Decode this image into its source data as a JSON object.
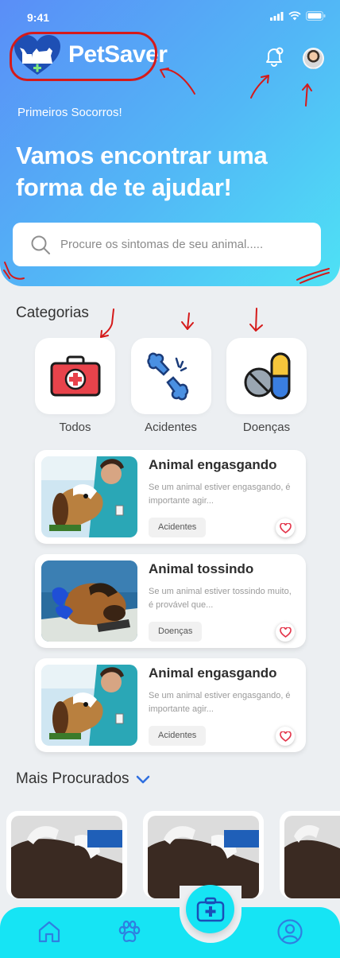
{
  "status": {
    "time": "9:41"
  },
  "header": {
    "brand": "PetSaver",
    "subtitle": "Primeiros Socorros!",
    "headline": "Vamos encontrar uma forma de te ajudar!"
  },
  "search": {
    "placeholder": "Procure os sintomas de seu animal....."
  },
  "categories": {
    "title": "Categorias",
    "items": [
      {
        "label": "Todos",
        "icon": "first-aid-kit-icon"
      },
      {
        "label": "Acidentes",
        "icon": "broken-bone-icon"
      },
      {
        "label": "Doenças",
        "icon": "pill-icon"
      }
    ]
  },
  "cards": [
    {
      "title": "Animal engasgando",
      "desc": "Se um animal estiver engasgando, é importante agir...",
      "tag": "Acidentes"
    },
    {
      "title": "Animal tossindo",
      "desc": "Se um animal estiver tossindo muito, é provável que...",
      "tag": "Doenças"
    },
    {
      "title": "Animal engasgando",
      "desc": "Se um animal estiver engasgando, é importante agir...",
      "tag": "Acidentes"
    }
  ],
  "popular": {
    "title": "Mais Procurados"
  },
  "nav": {
    "items": [
      "home-icon",
      "paw-icon",
      "first-aid-icon",
      "profile-icon"
    ]
  },
  "colors": {
    "accent": "#16e4f4",
    "gradient_start": "#5a8ef7",
    "gradient_end": "#4ee2f5",
    "annotation": "#d51a1a",
    "heart": "#e3344a"
  }
}
